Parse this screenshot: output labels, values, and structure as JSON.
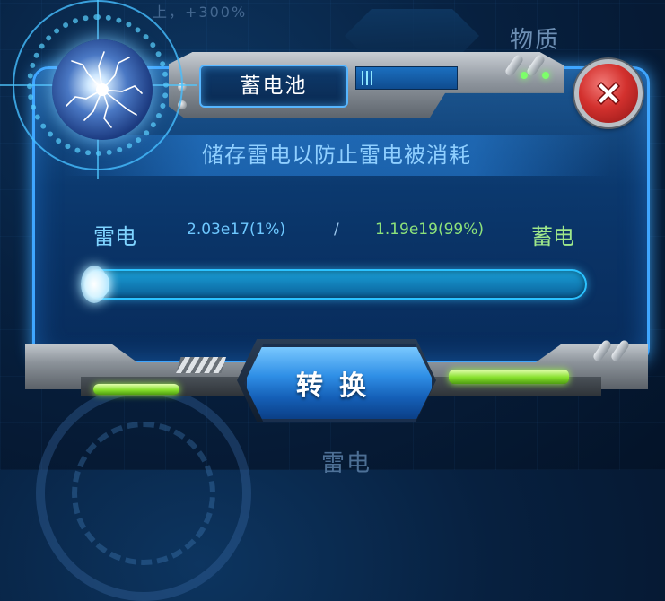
{
  "background": {
    "top_label": "物质",
    "bottom_label": "雷电",
    "top_small_label": "上，+300%"
  },
  "dialog": {
    "title": "蓄电池",
    "description": "储存雷电以防止雷电被消耗",
    "close_icon": "close-x-icon",
    "orb_icon": "lightning-orb-icon"
  },
  "transfer": {
    "left_label": "雷电",
    "left_value": "2.03e17(1%)",
    "separator": "/",
    "right_value": "1.19e19(99%)",
    "right_label": "蓄电",
    "progress_fraction": 0.01
  },
  "actions": {
    "convert_label": "转换"
  },
  "colors": {
    "accent_blue": "#3fa6ff",
    "accent_green": "#86e02c",
    "close_red": "#d3312e"
  }
}
